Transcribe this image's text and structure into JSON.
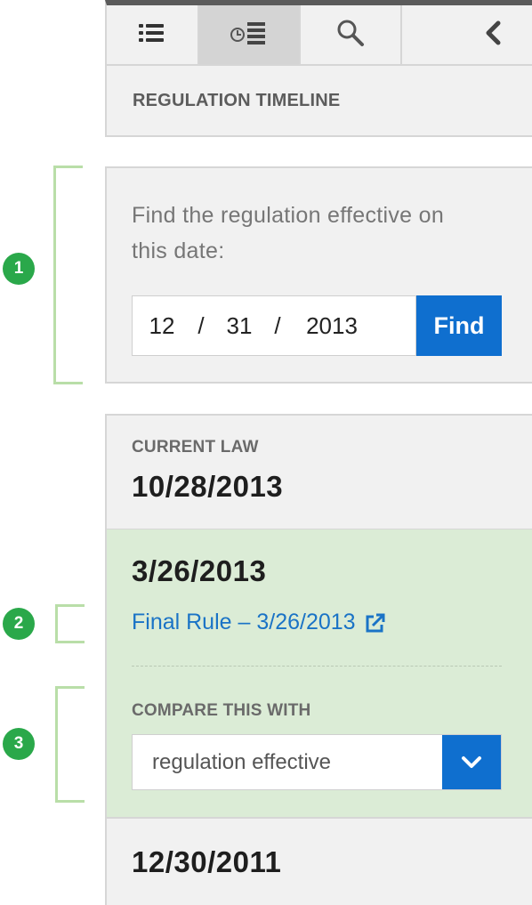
{
  "toolbar": {
    "tabs": [
      {
        "icon": "list-icon",
        "active": false
      },
      {
        "icon": "timeline-icon",
        "active": true
      },
      {
        "icon": "search-icon",
        "active": false
      },
      {
        "icon": "chevron-left-icon",
        "active": false
      }
    ]
  },
  "panel_title": "REGULATION TIMELINE",
  "find": {
    "prompt_line1": "Find the regulation effective on",
    "prompt_line2": "this date:",
    "month": "12",
    "day": "31",
    "year": "2013",
    "separator": "/",
    "button_label": "Find"
  },
  "annotations": [
    "1",
    "2",
    "3"
  ],
  "current": {
    "label": "CURRENT LAW",
    "date": "10/28/2013"
  },
  "selected": {
    "date": "3/26/2013",
    "link_label": "Final Rule – 3/26/2013",
    "compare_label": "COMPARE THIS WITH",
    "compare_value": "regulation effective"
  },
  "older": {
    "date": "12/30/2011"
  },
  "colors": {
    "accent": "#0f6fcf",
    "selected_bg": "#dbecd6",
    "badge": "#2aa84a",
    "bracket": "#b9dea8",
    "panel_bg": "#f1f1f1"
  }
}
